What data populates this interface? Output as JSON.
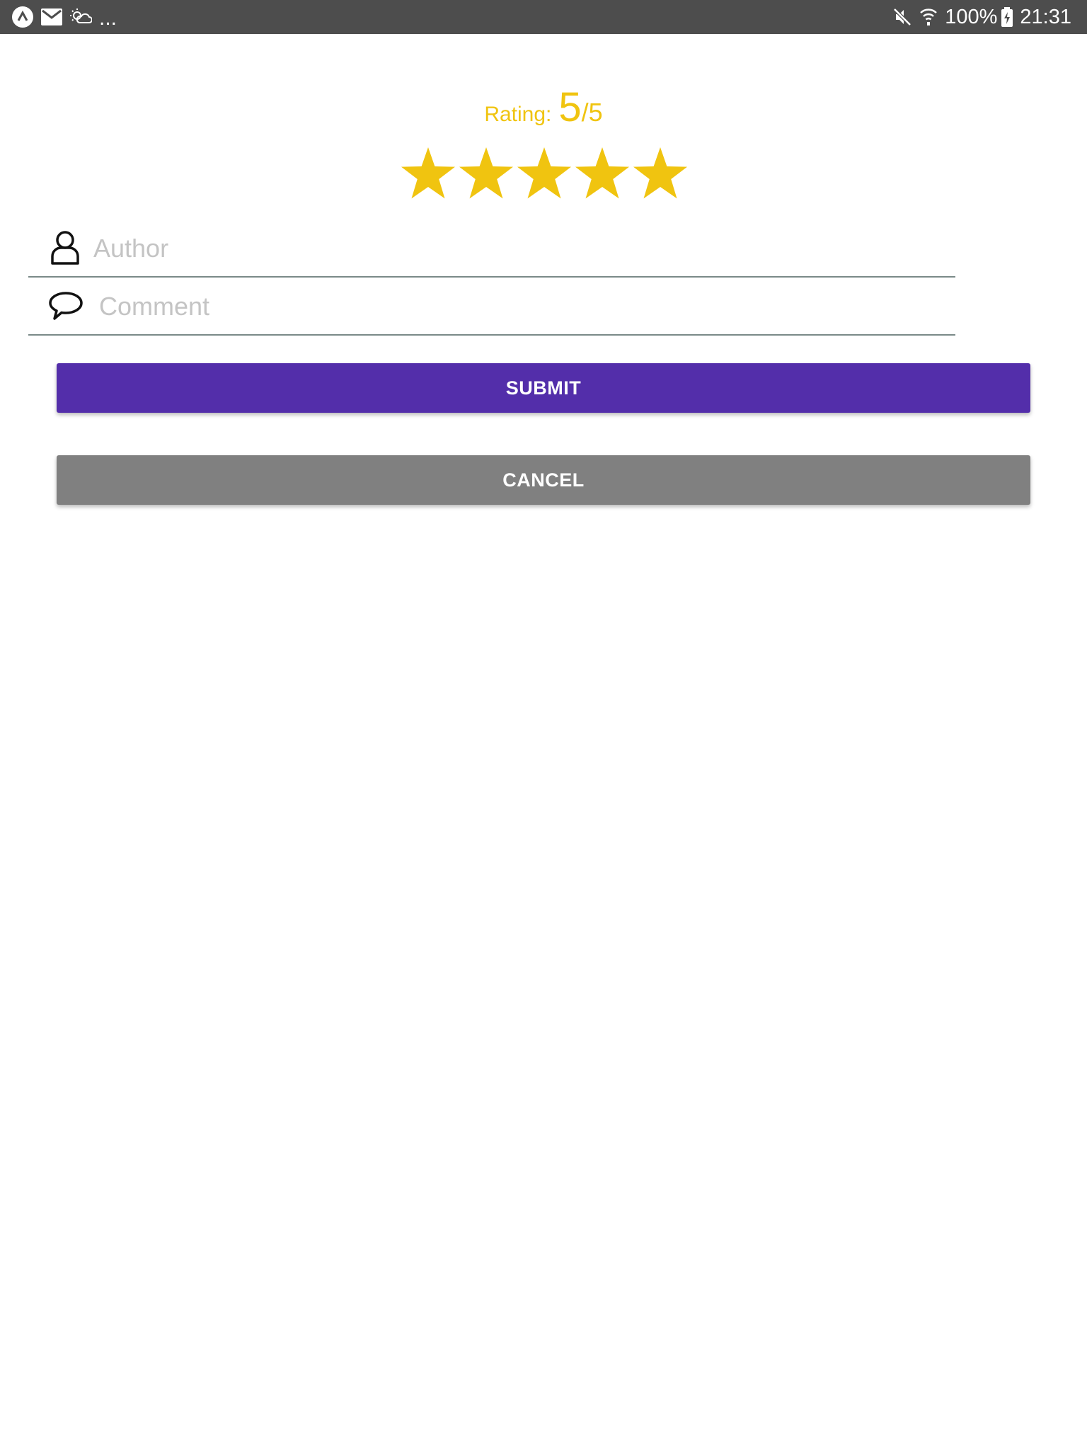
{
  "status_bar": {
    "left_icons": [
      "android-notification-icon",
      "mail-icon",
      "weather-icon"
    ],
    "overflow": "...",
    "right_icons": [
      "mute-icon",
      "wifi-icon",
      "battery-charging-icon"
    ],
    "battery": "100%",
    "time": "21:31"
  },
  "rating": {
    "label": "Rating:",
    "value": "5",
    "separator": "/",
    "max": "5",
    "stars_filled": 5,
    "stars_total": 5,
    "star_color": "#f0c410"
  },
  "form": {
    "author": {
      "placeholder": "Author",
      "value": "",
      "icon": "user-icon"
    },
    "comment": {
      "placeholder": "Comment",
      "value": "",
      "icon": "speech-bubble-icon"
    }
  },
  "buttons": {
    "submit": {
      "label": "SUBMIT",
      "color": "#532eaa"
    },
    "cancel": {
      "label": "CANCEL",
      "color": "#808080"
    }
  }
}
